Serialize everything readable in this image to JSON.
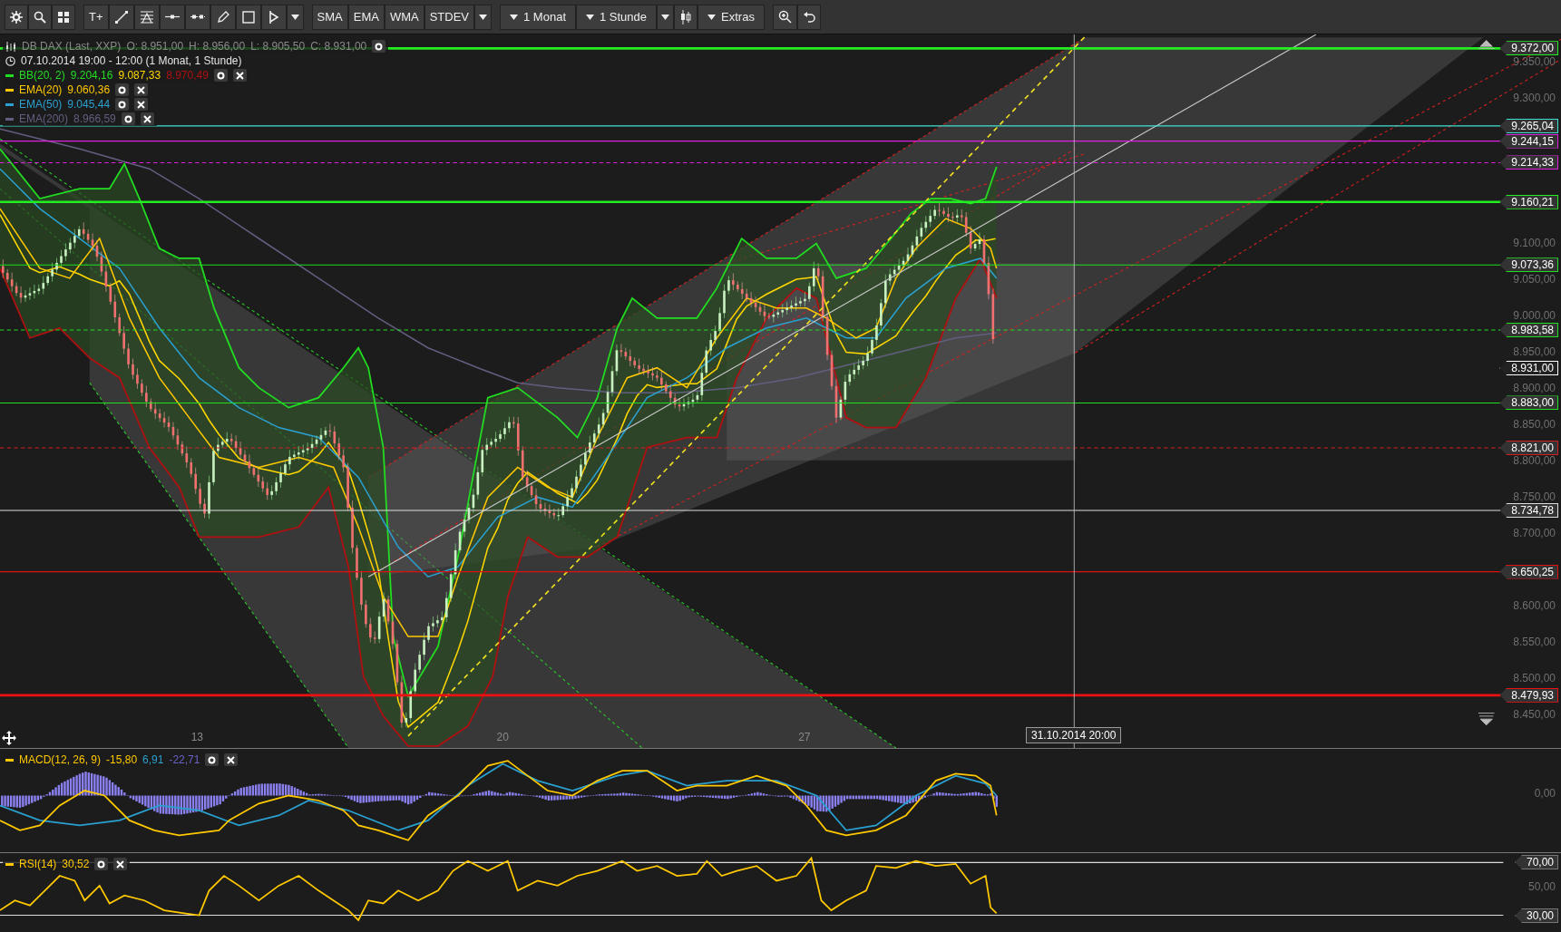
{
  "toolbar": {
    "text_tool": "T+",
    "indicator_buttons": [
      "SMA",
      "EMA",
      "WMA",
      "STDEV"
    ],
    "range_dropdowns": [
      "1 Monat",
      "1 Stunde"
    ],
    "extras_button": "Extras"
  },
  "legend": {
    "instrument": "DB DAX (Last, XXP)",
    "ohlc": [
      "O: 8.951,00",
      "H: 8.956,00",
      "L: 8.905,50",
      "C: 8.931,00"
    ],
    "period": "07.10.2014 19:00 - 12:00 (1 Monat, 1 Stunde)",
    "indicators": [
      {
        "name": "BB(20, 2)",
        "color": "#22dd22",
        "values": [
          {
            "text": "9.204,16",
            "color": "#22dd22"
          },
          {
            "text": "9.087,33",
            "color": "#ffd700"
          },
          {
            "text": "8.970,49",
            "color": "#b01010"
          }
        ]
      },
      {
        "name": "EMA(20)",
        "color": "#ffc800",
        "values": [
          {
            "text": "9.060,36",
            "color": "#ffc800"
          }
        ]
      },
      {
        "name": "EMA(50)",
        "color": "#2aa0d0",
        "values": [
          {
            "text": "9.045,44",
            "color": "#2aa0d0"
          }
        ]
      },
      {
        "name": "EMA(200)",
        "color": "#625e80",
        "values": [
          {
            "text": "8.966,59",
            "color": "#625e80"
          }
        ]
      }
    ]
  },
  "price_axis": {
    "ticks": [
      "9.350,00",
      "9.300,00",
      "9.100,00",
      "9.050,00",
      "9.000,00",
      "8.950,00",
      "8.900,00",
      "8.850,00",
      "8.800,00",
      "8.750,00",
      "8.700,00",
      "8.600,00",
      "8.550,00",
      "8.500,00",
      "8.450,00"
    ],
    "markers": [
      {
        "label": "9.372,00",
        "color": "#22ee22",
        "kind": "thick"
      },
      {
        "label": "9.265,04",
        "color": "#40e0d0",
        "kind": "solid"
      },
      {
        "label": "9.244,15",
        "color": "#e020e0",
        "kind": "solid"
      },
      {
        "label": "9.214,33",
        "color": "#e020e0",
        "kind": "dashed"
      },
      {
        "label": "9.160,21",
        "color": "#22ee22",
        "kind": "thick"
      },
      {
        "label": "9.073,36",
        "color": "#22dd22",
        "kind": "solid"
      },
      {
        "label": "8.983,58",
        "color": "#22dd22",
        "kind": "dashed"
      },
      {
        "label": "8.931,00",
        "color": "#ffffff",
        "kind": "current"
      },
      {
        "label": "8.883,00",
        "color": "#22dd22",
        "kind": "solid"
      },
      {
        "label": "8.821,00",
        "color": "#cc2020",
        "kind": "dashed"
      },
      {
        "label": "8.734,78",
        "color": "#dddddd",
        "kind": "solid"
      },
      {
        "label": "8.650,25",
        "color": "#dd1111",
        "kind": "solid"
      },
      {
        "label": "8.479,93",
        "color": "#ee1111",
        "kind": "thick"
      }
    ]
  },
  "time_axis": {
    "labels": [
      "13",
      "20",
      "27"
    ],
    "cursor_label": "31.10.2014 20:00"
  },
  "macd": {
    "name": "MACD(12, 26, 9)",
    "values": [
      {
        "text": "-15,80",
        "color": "#ffc800"
      },
      {
        "text": "6,91",
        "color": "#2aa0d0"
      },
      {
        "text": "-22,71",
        "color": "#6a62c8"
      }
    ],
    "ticks": [
      "0,00"
    ]
  },
  "rsi": {
    "name": "RSI(14)",
    "values": [
      {
        "text": "30,52",
        "color": "#ffc800"
      }
    ],
    "markers": [
      "70,00",
      "30,00"
    ],
    "ticks": [
      "50,00"
    ]
  }
}
